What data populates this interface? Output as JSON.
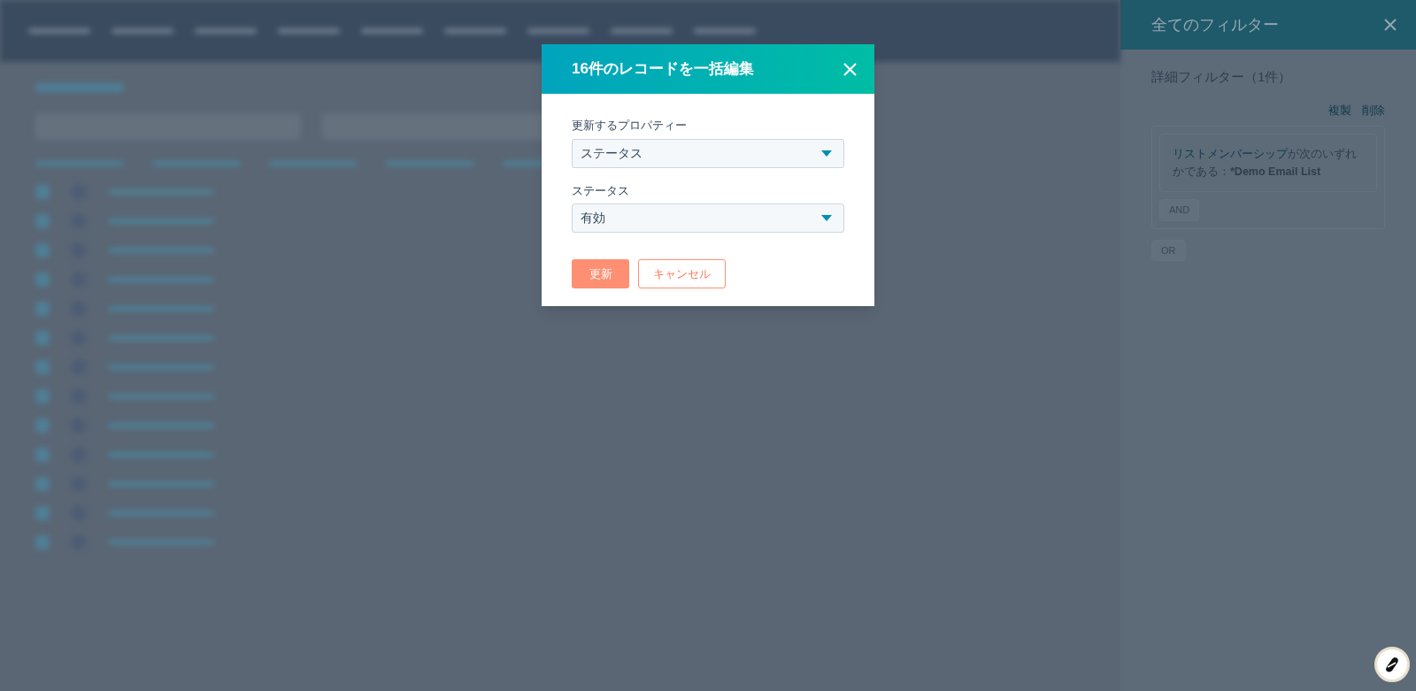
{
  "modal": {
    "title": "16件のレコードを一括編集",
    "fields": [
      {
        "label": "更新するプロパティー",
        "value": "ステータス"
      },
      {
        "label": "ステータス",
        "value": "有効"
      }
    ],
    "buttons": [
      {
        "label": "更新",
        "kind": "primary"
      },
      {
        "label": "キャンセル",
        "kind": "secondary"
      }
    ]
  },
  "filter_panel": {
    "title": "全てのフィルター",
    "section": "詳細フィルター（1件）",
    "actions": [
      "複製",
      "削除"
    ],
    "filter": {
      "property": "リストメンバーシップ",
      "condition": "が次のいずれかである：",
      "value": "*Demo Email List"
    },
    "and_button": "AND",
    "or_button": "OR"
  }
}
